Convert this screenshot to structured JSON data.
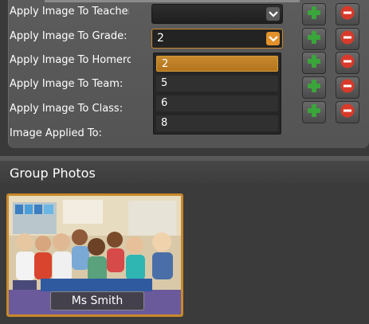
{
  "apply_panel": {
    "rows": [
      {
        "label": "Apply Image To Teacher:",
        "value": ""
      },
      {
        "label": "Apply Image To Grade:",
        "value": "2"
      },
      {
        "label": "Apply Image To Homeroom:",
        "value": ""
      },
      {
        "label": "Apply Image To Team:",
        "value": ""
      },
      {
        "label": "Apply Image To Class:",
        "value": ""
      }
    ],
    "applied_label": "Image Applied To:",
    "grade_options": [
      "2",
      "5",
      "6",
      "8"
    ],
    "selected_option": "2"
  },
  "group_photos": {
    "title": "Group Photos",
    "photos": [
      {
        "name": "Ms Smith"
      }
    ]
  },
  "colors": {
    "accent": "#e2912b",
    "add_green": "#3aa53a",
    "remove_red": "#d83a2a",
    "panel": "#575757",
    "background": "#3a3a3a"
  },
  "icons": {
    "add": "plus-icon",
    "remove": "minus-icon",
    "dropdown": "chevron-down-icon"
  }
}
